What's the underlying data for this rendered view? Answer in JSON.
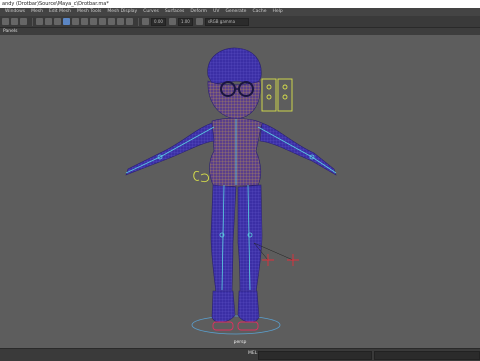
{
  "window": {
    "title": "andy (Drotbar)Source\\Maya_c\\Drotbar.ma*"
  },
  "menu": {
    "items": [
      "Windows",
      "Mesh",
      "Edit Mesh",
      "Mesh Tools",
      "Mesh Display",
      "Curves",
      "Surfaces",
      "Deform",
      "UV",
      "Generate",
      "Cache",
      "Help"
    ]
  },
  "toolbar": {
    "field_a": "0.00",
    "field_b": "1.00",
    "color_space": "sRGB gamma"
  },
  "panel": {
    "menu_label": "Panels"
  },
  "viewport": {
    "camera_label": "persp"
  },
  "statusbar": {
    "script_lang": "MEL"
  },
  "colors": {
    "mesh": "#3a2fa8",
    "wire": "#c9a34a",
    "joint": "#5ad0e0",
    "control": "#d8e04a",
    "locator": "#e0303a"
  }
}
